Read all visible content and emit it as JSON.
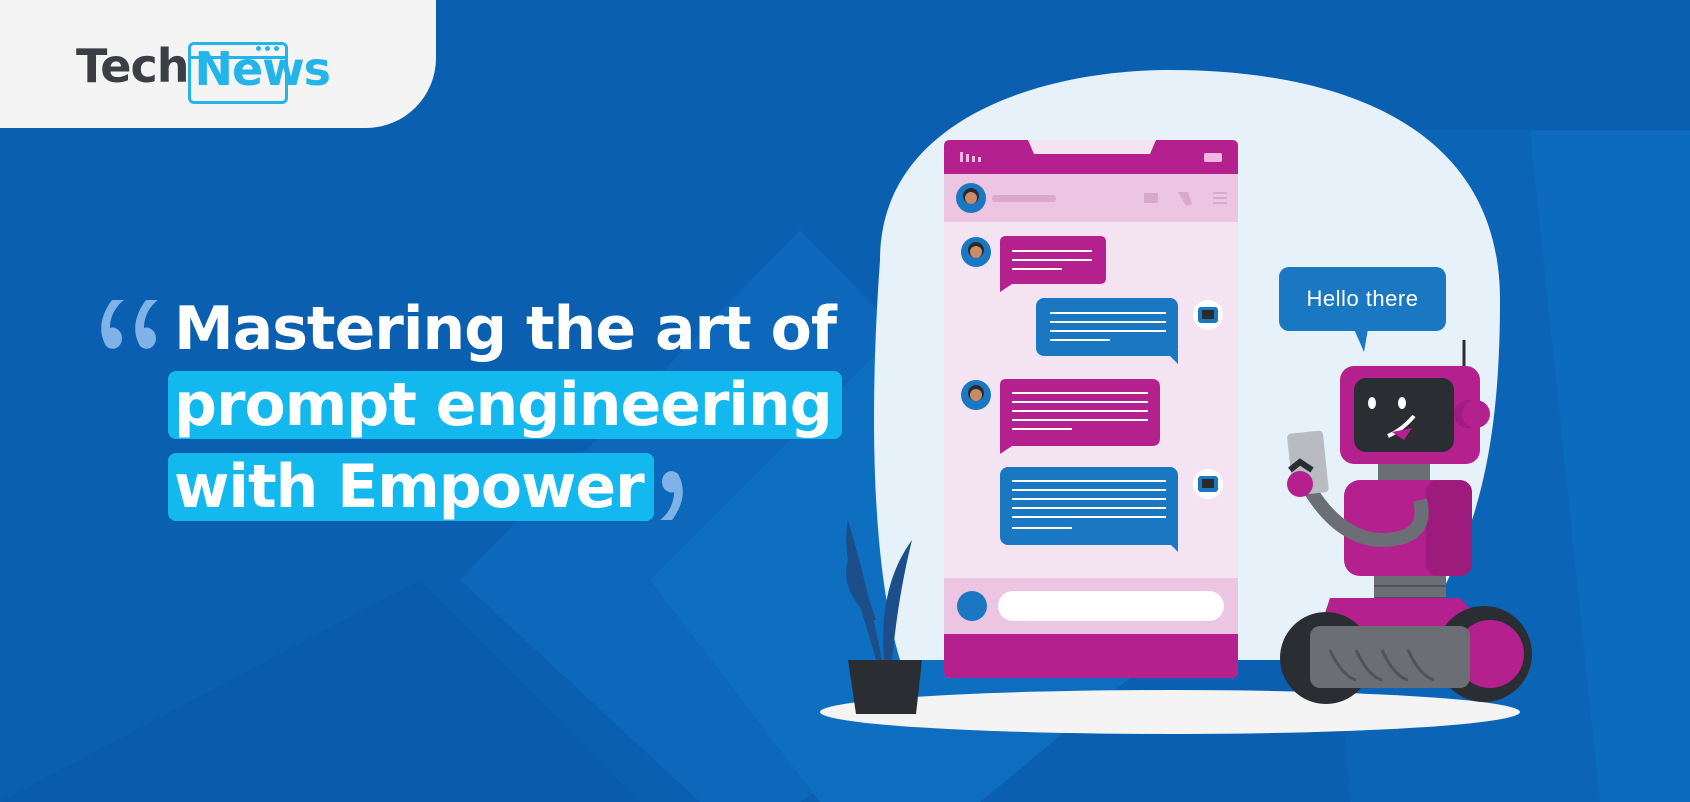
{
  "brand": {
    "part1": "Tech",
    "part2": "News"
  },
  "headline": {
    "line1": "Mastering the art of",
    "line2": "prompt engineering",
    "line3": "with Empower"
  },
  "speech_bubble": {
    "text": "Hello there"
  },
  "colors": {
    "background": "#0a5fb0",
    "highlight": "#13b8ef",
    "magenta": "#b5208f",
    "logo_dark": "#3b3f45",
    "logo_blue": "#23b5ea"
  },
  "icons": [
    "open-quote-icon",
    "close-quote-icon",
    "chat-phone-illustration",
    "robot-illustration",
    "plant-illustration"
  ]
}
